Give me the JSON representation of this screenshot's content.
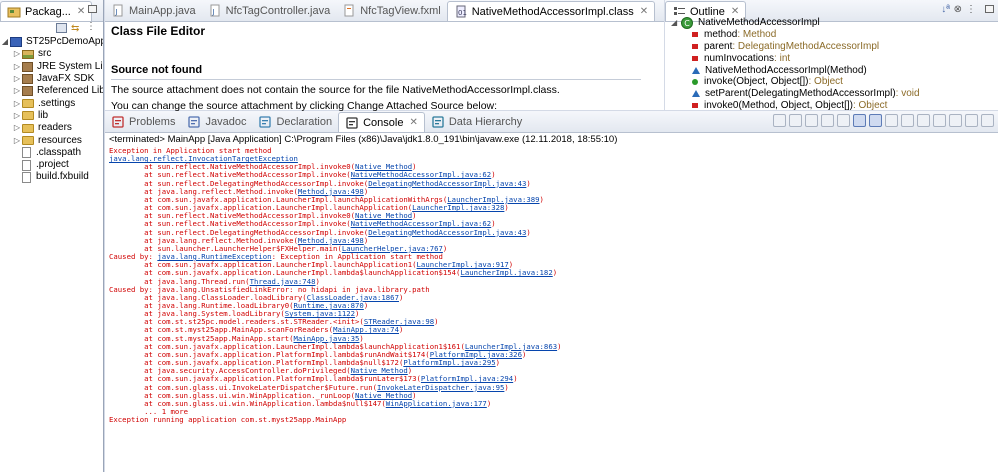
{
  "package_explorer": {
    "tab_label": "Packag...",
    "project": "ST25PcDemoApp",
    "items": [
      {
        "label": "src",
        "kind": "src"
      },
      {
        "label": "JRE System Librar",
        "kind": "jar"
      },
      {
        "label": "JavaFX SDK",
        "kind": "jar"
      },
      {
        "label": "Referenced Librar",
        "kind": "jar"
      },
      {
        "label": ".settings",
        "kind": "folder"
      },
      {
        "label": "lib",
        "kind": "folder"
      },
      {
        "label": "readers",
        "kind": "folder"
      },
      {
        "label": "resources",
        "kind": "folder"
      },
      {
        "label": ".classpath",
        "kind": "file"
      },
      {
        "label": ".project",
        "kind": "file"
      },
      {
        "label": "build.fxbuild",
        "kind": "file"
      }
    ]
  },
  "editor": {
    "tabs": [
      {
        "label": "MainApp.java"
      },
      {
        "label": "NfcTagController.java"
      },
      {
        "label": "NfcTagView.fxml"
      },
      {
        "label": "NativeMethodAccessorImpl.class"
      }
    ],
    "title": "Class File Editor",
    "section": "Source not found",
    "line1": "The source attachment does not contain the source for the file NativeMethodAccessorImpl.class.",
    "line2": "You can change the source attachment by clicking Change Attached Source below:"
  },
  "outline": {
    "tab_label": "Outline",
    "class_name": "NativeMethodAccessorImpl",
    "members": [
      {
        "name": "method",
        "type": " : Method",
        "vis": "private-final"
      },
      {
        "name": "parent",
        "type": " : DelegatingMethodAccessorImpl",
        "vis": "private"
      },
      {
        "name": "numInvocations",
        "type": " : int",
        "vis": "private"
      },
      {
        "name": "NativeMethodAccessorImpl(Method)",
        "type": "",
        "vis": "constructor"
      },
      {
        "name": "invoke(Object, Object[])",
        "type": " : Object",
        "vis": "public"
      },
      {
        "name": "setParent(DelegatingMethodAccessorImpl)",
        "type": " : void",
        "vis": "package"
      },
      {
        "name": "invoke0(Method, Object, Object[])",
        "type": " : Object",
        "vis": "private"
      }
    ]
  },
  "console": {
    "tabs": [
      {
        "label": "Problems"
      },
      {
        "label": "Javadoc"
      },
      {
        "label": "Declaration"
      },
      {
        "label": "Console"
      },
      {
        "label": "Data Hierarchy"
      }
    ],
    "header": "<terminated> MainApp [Java Application] C:\\Program Files (x86)\\Java\\jdk1.8.0_191\\bin\\javaw.exe (12.11.2018, 18:55:10)",
    "lines": [
      {
        "pre": "Exception in Application start method",
        "link": "",
        "post": ""
      },
      {
        "pre": "",
        "link": "java.lang.reflect.InvocationTargetException",
        "post": ""
      },
      {
        "pre": "\tat sun.reflect.NativeMethodAccessorImpl.invoke0(",
        "link": "Native Method",
        "post": ")"
      },
      {
        "pre": "\tat sun.reflect.NativeMethodAccessorImpl.invoke(",
        "link": "NativeMethodAccessorImpl.java:62",
        "post": ")"
      },
      {
        "pre": "\tat sun.reflect.DelegatingMethodAccessorImpl.invoke(",
        "link": "DelegatingMethodAccessorImpl.java:43",
        "post": ")"
      },
      {
        "pre": "\tat java.lang.reflect.Method.invoke(",
        "link": "Method.java:498",
        "post": ")"
      },
      {
        "pre": "\tat com.sun.javafx.application.LauncherImpl.launchApplicationWithArgs(",
        "link": "LauncherImpl.java:389",
        "post": ")"
      },
      {
        "pre": "\tat com.sun.javafx.application.LauncherImpl.launchApplication(",
        "link": "LauncherImpl.java:328",
        "post": ")"
      },
      {
        "pre": "\tat sun.reflect.NativeMethodAccessorImpl.invoke0(",
        "link": "Native Method",
        "post": ")"
      },
      {
        "pre": "\tat sun.reflect.NativeMethodAccessorImpl.invoke(",
        "link": "NativeMethodAccessorImpl.java:62",
        "post": ")"
      },
      {
        "pre": "\tat sun.reflect.DelegatingMethodAccessorImpl.invoke(",
        "link": "DelegatingMethodAccessorImpl.java:43",
        "post": ")"
      },
      {
        "pre": "\tat java.lang.reflect.Method.invoke(",
        "link": "Method.java:498",
        "post": ")"
      },
      {
        "pre": "\tat sun.launcher.LauncherHelper$FXHelper.main(",
        "link": "LauncherHelper.java:767",
        "post": ")"
      },
      {
        "pre": "Caused by: ",
        "link": "java.lang.RuntimeException",
        "post": ": Exception in Application start method"
      },
      {
        "pre": "\tat com.sun.javafx.application.LauncherImpl.launchApplication1(",
        "link": "LauncherImpl.java:917",
        "post": ")"
      },
      {
        "pre": "\tat com.sun.javafx.application.LauncherImpl.lambda$launchApplication$154(",
        "link": "LauncherImpl.java:182",
        "post": ")"
      },
      {
        "pre": "\tat java.lang.Thread.run(",
        "link": "Thread.java:748",
        "post": ")"
      },
      {
        "pre": "Caused by: java.lang.UnsatisfiedLinkError: no hidapi in java.library.path",
        "link": "",
        "post": ""
      },
      {
        "pre": "\tat java.lang.ClassLoader.loadLibrary(",
        "link": "ClassLoader.java:1867",
        "post": ")"
      },
      {
        "pre": "\tat java.lang.Runtime.loadLibrary0(",
        "link": "Runtime.java:870",
        "post": ")"
      },
      {
        "pre": "\tat java.lang.System.loadLibrary(",
        "link": "System.java:1122",
        "post": ")"
      },
      {
        "pre": "\tat com.st.st25pc.model.readers.st.STReader.<init>(",
        "link": "STReader.java:98",
        "post": ")"
      },
      {
        "pre": "\tat com.st.myst25app.MainApp.scanForReaders(",
        "link": "MainApp.java:74",
        "post": ")"
      },
      {
        "pre": "\tat com.st.myst25app.MainApp.start(",
        "link": "MainApp.java:35",
        "post": ")"
      },
      {
        "pre": "\tat com.sun.javafx.application.LauncherImpl.lambda$launchApplication1$161(",
        "link": "LauncherImpl.java:863",
        "post": ")"
      },
      {
        "pre": "\tat com.sun.javafx.application.PlatformImpl.lambda$runAndWait$174(",
        "link": "PlatformImpl.java:326",
        "post": ")"
      },
      {
        "pre": "\tat com.sun.javafx.application.PlatformImpl.lambda$null$172(",
        "link": "PlatformImpl.java:295",
        "post": ")"
      },
      {
        "pre": "\tat java.security.AccessController.doPrivileged(",
        "link": "Native Method",
        "post": ")"
      },
      {
        "pre": "\tat com.sun.javafx.application.PlatformImpl.lambda$runLater$173(",
        "link": "PlatformImpl.java:294",
        "post": ")"
      },
      {
        "pre": "\tat com.sun.glass.ui.InvokeLaterDispatcher$Future.run(",
        "link": "InvokeLaterDispatcher.java:95",
        "post": ")"
      },
      {
        "pre": "\tat com.sun.glass.ui.win.WinApplication._runLoop(",
        "link": "Native Method",
        "post": ")"
      },
      {
        "pre": "\tat com.sun.glass.ui.win.WinApplication.lambda$null$147(",
        "link": "WinApplication.java:177",
        "post": ")"
      },
      {
        "pre": "\t... 1 more",
        "link": "",
        "post": ""
      },
      {
        "pre": "Exception running application com.st.myst25app.MainApp",
        "link": "",
        "post": ""
      }
    ]
  }
}
